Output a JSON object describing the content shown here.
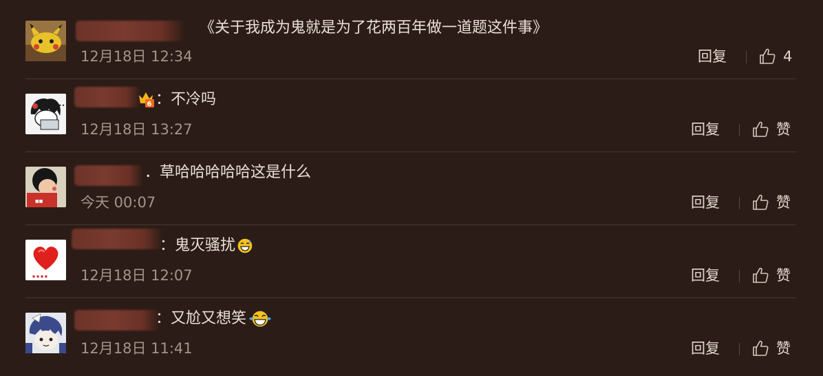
{
  "comments": [
    {
      "text": "《关于我成为鬼就是为了花两百年做一道题这件事》",
      "time": "12月18日 12:34",
      "reply_label": "回复",
      "like_label": "4"
    },
    {
      "text": "：不冷吗",
      "time": "12月18日 13:27",
      "reply_label": "回复",
      "like_label": "赞"
    },
    {
      "text": "．草哈哈哈哈哈这是什么",
      "time": "今天 00:07",
      "reply_label": "回复",
      "like_label": "赞"
    },
    {
      "text": "：鬼灭骚扰",
      "time": "12月18日 12:07",
      "reply_label": "回复",
      "like_label": "赞"
    },
    {
      "text": "：又尬又想笑",
      "time": "12月18日 11:41",
      "reply_label": "回复",
      "like_label": "赞"
    }
  ],
  "icons": {
    "like": "thumbs-up-icon",
    "vip": "vip-badge-icon",
    "emoji_sweat": "grinning-sweat-emoji-icon",
    "emoji_laugh": "tears-of-joy-emoji-icon"
  },
  "colors": {
    "background": "#2b1c17",
    "text": "#eadfd6",
    "meta": "#a4948a",
    "divider": "#4a3830"
  }
}
